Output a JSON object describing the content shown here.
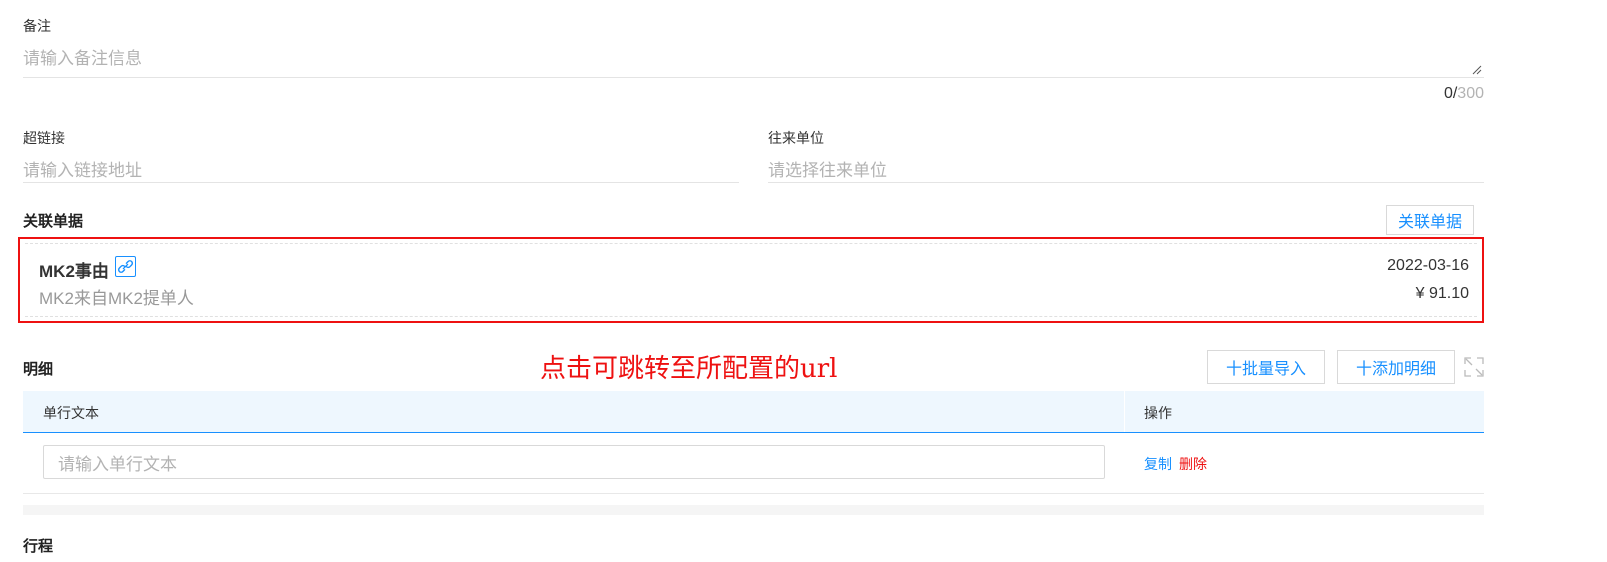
{
  "remark": {
    "label": "备注",
    "placeholder": "请输入备注信息",
    "count": "0/",
    "max": "300"
  },
  "hyperlink": {
    "label": "超链接",
    "placeholder": "请输入链接地址"
  },
  "partner": {
    "label": "往来单位",
    "placeholder": "请选择往来单位"
  },
  "related_docs": {
    "title": "关联单据",
    "button_label": "关联单据",
    "card": {
      "title": "MK2事由",
      "subtitle": "MK2来自MK2提单人",
      "date": "2022-03-16",
      "amount": "¥ 91.10"
    }
  },
  "annotation_text": "点击可跳转至所配置的url",
  "details": {
    "title": "明细",
    "import_button": "十批量导入",
    "add_button": "十添加明细",
    "columns": [
      "单行文本",
      "操作"
    ],
    "row": {
      "placeholder": "请输入单行文本",
      "copy": "复制",
      "delete": "删除"
    }
  },
  "itinerary": {
    "title": "行程"
  },
  "colors": {
    "accent": "#1890ff",
    "danger": "#ee1111",
    "placeholder": "#b3b3b3"
  }
}
